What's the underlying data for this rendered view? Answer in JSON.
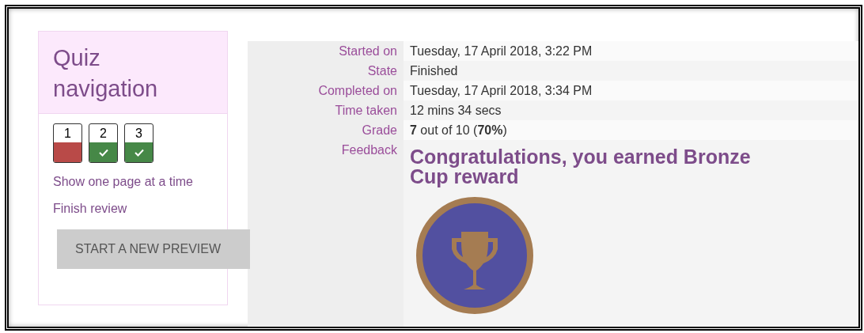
{
  "quiz_navigation": {
    "title": "Quiz navigation",
    "questions": [
      {
        "number": "1",
        "correct": false
      },
      {
        "number": "2",
        "correct": true
      },
      {
        "number": "3",
        "correct": true
      }
    ],
    "links": [
      "Show one page at a time",
      "Finish review"
    ],
    "button": "START A NEW PREVIEW"
  },
  "summary": {
    "rows": [
      {
        "label": "Started on",
        "value": "Tuesday, 17 April 2018, 3:22 PM"
      },
      {
        "label": "State",
        "value": "Finished"
      },
      {
        "label": "Completed on",
        "value": "Tuesday, 17 April 2018, 3:34 PM"
      },
      {
        "label": "Time taken",
        "value": "12 mins 34 secs"
      },
      {
        "label": "Grade",
        "value": "**7** out of 10 (**70%**)"
      }
    ],
    "feedback": {
      "label": "Feedback",
      "heading": "Congratulations, you earned Bronze Cup reward"
    }
  }
}
